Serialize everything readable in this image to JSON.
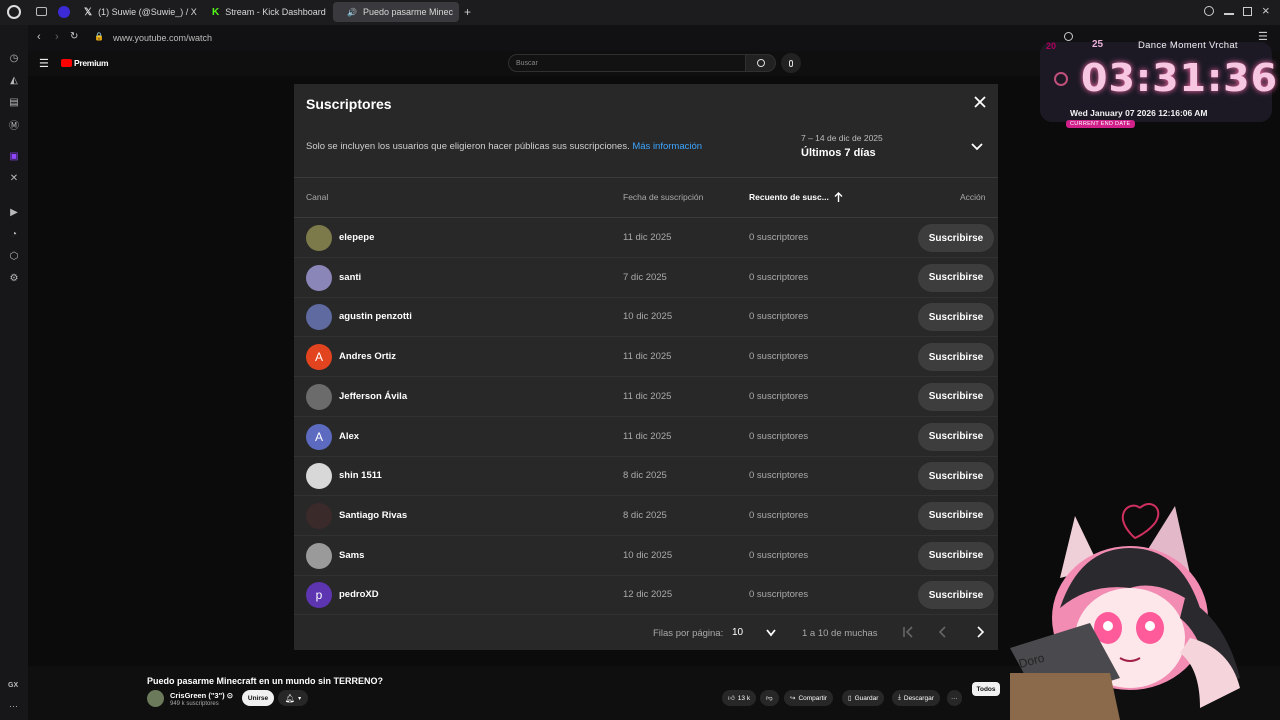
{
  "browser": {
    "tabs": [
      {
        "label": "(1) Suwie (@Suwie_) / X",
        "active": false
      },
      {
        "label": "Stream - Kick Dashboard",
        "active": false
      },
      {
        "label": "Puedo pasarme Minec",
        "active": true
      }
    ],
    "new_tab_label": "+",
    "url": "www.youtube.com/watch",
    "sidebar_label": "GX"
  },
  "youtube": {
    "logo_label": "Premium",
    "search_placeholder": "Buscar"
  },
  "modal": {
    "title": "Suscriptores",
    "notice": "Solo se incluyen los usuarios que eligieron hacer públicas sus suscripciones.",
    "notice_link": "Más información",
    "range_dates": "7 – 14 de dic de 2025",
    "range_label": "Últimos 7 días",
    "columns": {
      "channel": "Canal",
      "date": "Fecha de suscripción",
      "count": "Recuento de susc...",
      "action": "Acción"
    },
    "rows": [
      {
        "name": "elepepe",
        "date": "11 dic 2025",
        "subs": "0 suscriptores",
        "button": "Suscribirse",
        "initial": "",
        "color": "#7c7a4a"
      },
      {
        "name": "santi",
        "date": "7 dic 2025",
        "subs": "0 suscriptores",
        "button": "Suscribirse",
        "initial": "",
        "color": "#8a86b8"
      },
      {
        "name": "agustin penzotti",
        "date": "10 dic 2025",
        "subs": "0 suscriptores",
        "button": "Suscribirse",
        "initial": "",
        "color": "#5e6aa0"
      },
      {
        "name": "Andres Ortiz",
        "date": "11 dic 2025",
        "subs": "0 suscriptores",
        "button": "Suscribirse",
        "initial": "A",
        "color": "#e2441f"
      },
      {
        "name": "Jefferson Ávila",
        "date": "11 dic 2025",
        "subs": "0 suscriptores",
        "button": "Suscribirse",
        "initial": "",
        "color": "#6b6b6b"
      },
      {
        "name": "Alex",
        "date": "11 dic 2025",
        "subs": "0 suscriptores",
        "button": "Suscribirse",
        "initial": "A",
        "color": "#5c6bc0"
      },
      {
        "name": "shin 1511",
        "date": "8 dic 2025",
        "subs": "0 suscriptores",
        "button": "Suscribirse",
        "initial": "",
        "color": "#d8d8d8"
      },
      {
        "name": "Santiago Rivas",
        "date": "8 dic 2025",
        "subs": "0 suscriptores",
        "button": "Suscribirse",
        "initial": "",
        "color": "#3a2a2a"
      },
      {
        "name": "Sams",
        "date": "10 dic 2025",
        "subs": "0 suscriptores",
        "button": "Suscribirse",
        "initial": "",
        "color": "#9a9a9a"
      },
      {
        "name": "pedroXD",
        "date": "12 dic 2025",
        "subs": "0 suscriptores",
        "button": "Suscribirse",
        "initial": "p",
        "color": "#5e35b1"
      }
    ],
    "pager": {
      "rows_label": "Filas por página:",
      "rows_value": "10",
      "range": "1 a 10 de muchas"
    }
  },
  "widget": {
    "count_a": "20",
    "count_b": "25",
    "song": "Dance Moment Vrchat",
    "time": "03:31:36",
    "date": "Wed January 07 2026 12:16:06 AM",
    "badge": "CURRENT END DATE"
  },
  "video": {
    "title": "Puedo pasarme Minecraft en un mundo sin TERRENO?",
    "channel": "CrisGreen (\"3\") ⊙",
    "channel_subs": "949 k suscriptores",
    "join": "Unirse",
    "likes": "13 k",
    "share": "Compartir",
    "save": "Guardar",
    "download": "Descargar",
    "chip_all": "Todos",
    "more": "···"
  },
  "overlay_art": {
    "box_label": "Doro"
  },
  "colors": {
    "accent_link": "#3ea6ff",
    "yt_red": "#ff0000",
    "modal_bg": "#282828"
  }
}
